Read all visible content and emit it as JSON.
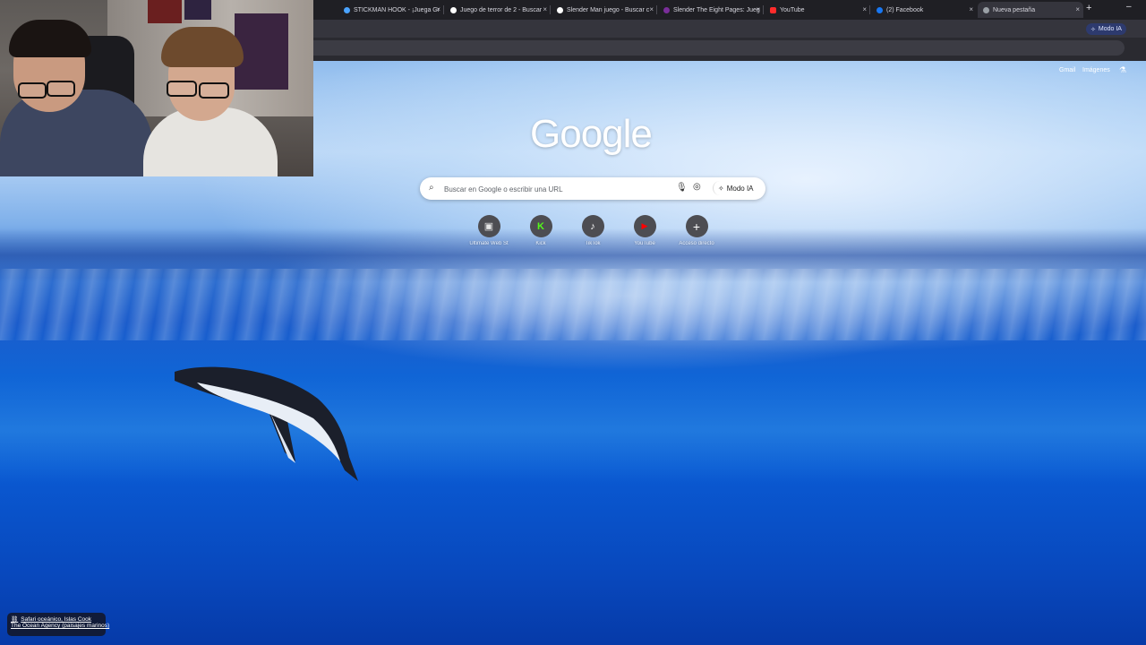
{
  "tabs": [
    {
      "title": "STICKMAN HOOK - ¡Juega Gr",
      "fav_color": "#4aa3ff"
    },
    {
      "title": "Juego de terror de 2 - Buscar",
      "fav_color": "#ffffff"
    },
    {
      "title": "Slender Man juego - Buscar c",
      "fav_color": "#ffffff"
    },
    {
      "title": "Slender The Eight Pages: Jueg",
      "fav_color": "#7a2e9a"
    },
    {
      "title": "YouTube",
      "fav_color": "#ff2b2b"
    },
    {
      "title": "(2) Facebook",
      "fav_color": "#1877f2"
    },
    {
      "title": "Nueva pestaña",
      "fav_color": "#9aa0a6"
    }
  ],
  "tab_close": "×",
  "new_tab": "+",
  "minimize": "–",
  "top_ai_mode": "Modo IA",
  "top_links": {
    "gmail": "Gmail",
    "images": "Imágenes"
  },
  "logo": "Google",
  "search": {
    "placeholder": "Buscar en Google o escribir una URL",
    "ai_mode": "Modo IA"
  },
  "shortcuts": [
    {
      "label": "Ultimate Web St",
      "icon": "image-icon",
      "glyph": "▣",
      "color": "#e5e5e5"
    },
    {
      "label": "Kick",
      "icon": "kick-icon",
      "glyph": "K",
      "color": "#53fc18"
    },
    {
      "label": "TikTok",
      "icon": "tiktok-icon",
      "glyph": "♪",
      "color": "#ffffff"
    },
    {
      "label": "YouTube",
      "icon": "youtube-icon",
      "glyph": "▶",
      "color": "#ff0000"
    },
    {
      "label": "Acceso directo",
      "icon": "plus-icon",
      "glyph": "+",
      "color": "#ffffff"
    }
  ],
  "attribution": {
    "title": "Safari oceánico, Islas Cook",
    "credit": "The Ocean Agency (paisajes marinos)"
  }
}
